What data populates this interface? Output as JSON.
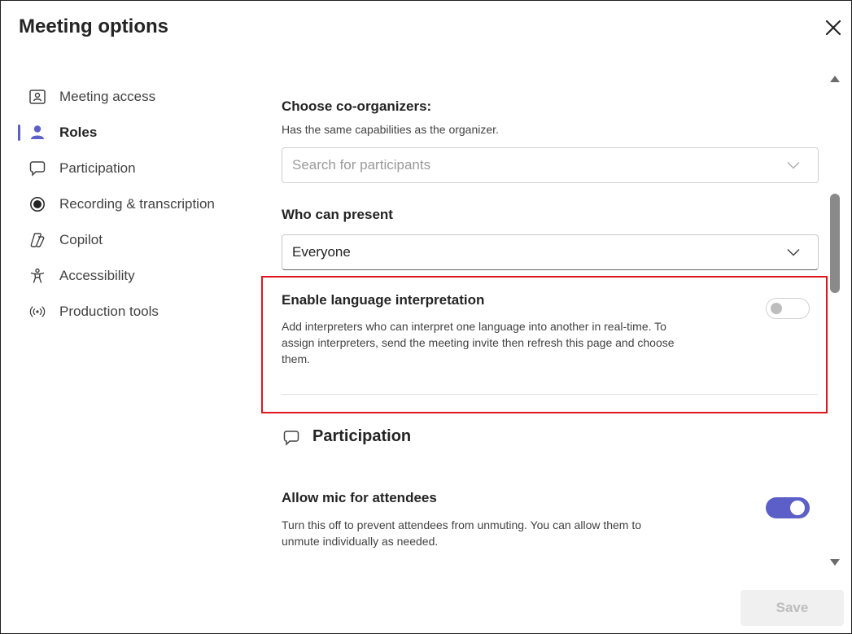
{
  "dialog": {
    "title": "Meeting options",
    "close_icon": "close-icon"
  },
  "sidebar": {
    "items": [
      {
        "label": "Meeting access",
        "icon": "meeting-access-icon",
        "active": false
      },
      {
        "label": "Roles",
        "icon": "person-icon",
        "active": true
      },
      {
        "label": "Participation",
        "icon": "chat-icon",
        "active": false
      },
      {
        "label": "Recording & transcription",
        "icon": "record-icon",
        "active": false
      },
      {
        "label": "Copilot",
        "icon": "copilot-icon",
        "active": false
      },
      {
        "label": "Accessibility",
        "icon": "accessibility-icon",
        "active": false
      },
      {
        "label": "Production tools",
        "icon": "broadcast-icon",
        "active": false
      }
    ],
    "accent": "#5b5fc7"
  },
  "roles": {
    "coorganizers_label": "Choose co-organizers:",
    "coorganizers_desc": "Has the same capabilities as the organizer.",
    "search_placeholder": "Search for participants",
    "present_label": "Who can present",
    "present_value": "Everyone",
    "interpretation_label": "Enable language interpretation",
    "interpretation_desc_line1": "Add interpreters who can interpret one language into another in real-time. To",
    "interpretation_desc_line2": "assign interpreters, send the meeting invite then refresh this page and choose",
    "interpretation_desc_line3": "them.",
    "interpretation_enabled": false
  },
  "participation": {
    "heading": "Participation",
    "mic_label": "Allow mic for attendees",
    "mic_desc_line1": "Turn this off to prevent attendees from unmuting. You can allow them to",
    "mic_desc_line2": "unmute individually as needed.",
    "mic_enabled": true
  },
  "footer": {
    "save_label": "Save"
  },
  "colors": {
    "accent": "#5b5fc7",
    "highlight": "#e0161f"
  }
}
